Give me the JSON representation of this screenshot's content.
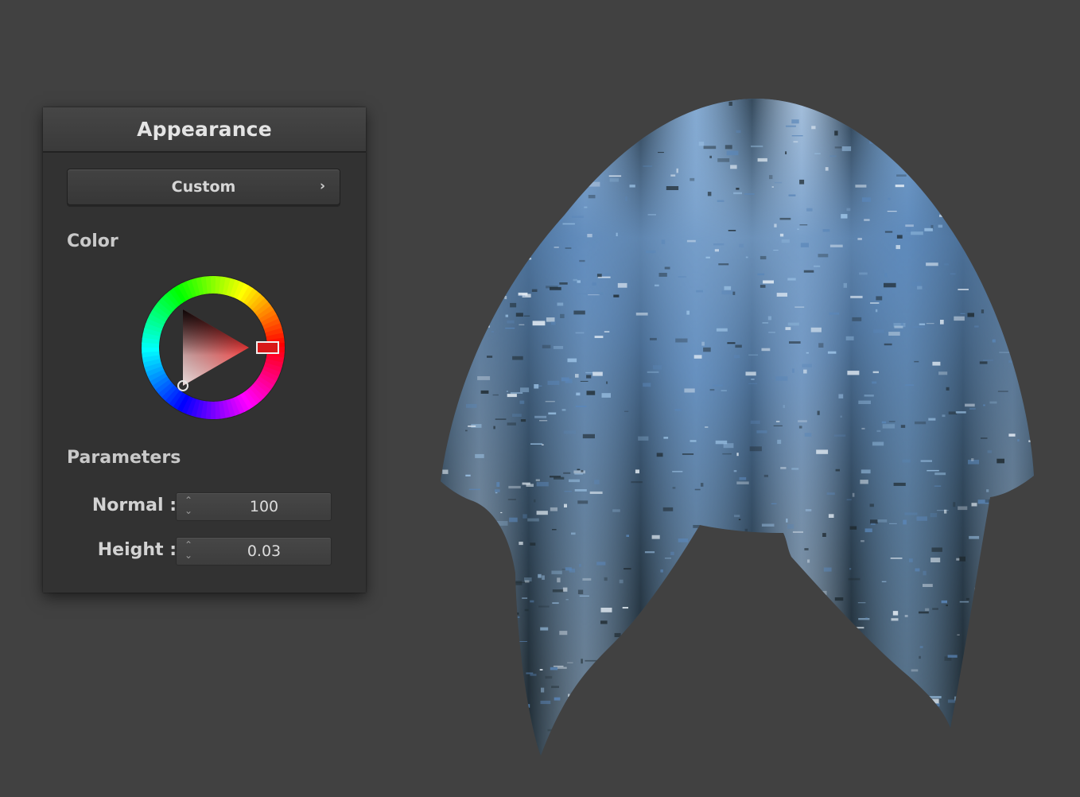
{
  "panel": {
    "title": "Appearance",
    "preset": {
      "label": "Custom",
      "chevron": "›"
    },
    "color_section": {
      "label": "Color",
      "selected_hue_hex": "#e01010"
    },
    "parameters_section": {
      "label": "Parameters",
      "normal": {
        "label": "Normal :",
        "value": "100"
      },
      "height": {
        "label": "Height :",
        "value": "0.03"
      }
    }
  },
  "viewport": {
    "material_colors": [
      "#5a86b8",
      "#9cc3e6",
      "#1f2a30",
      "#e9f1f8"
    ]
  }
}
